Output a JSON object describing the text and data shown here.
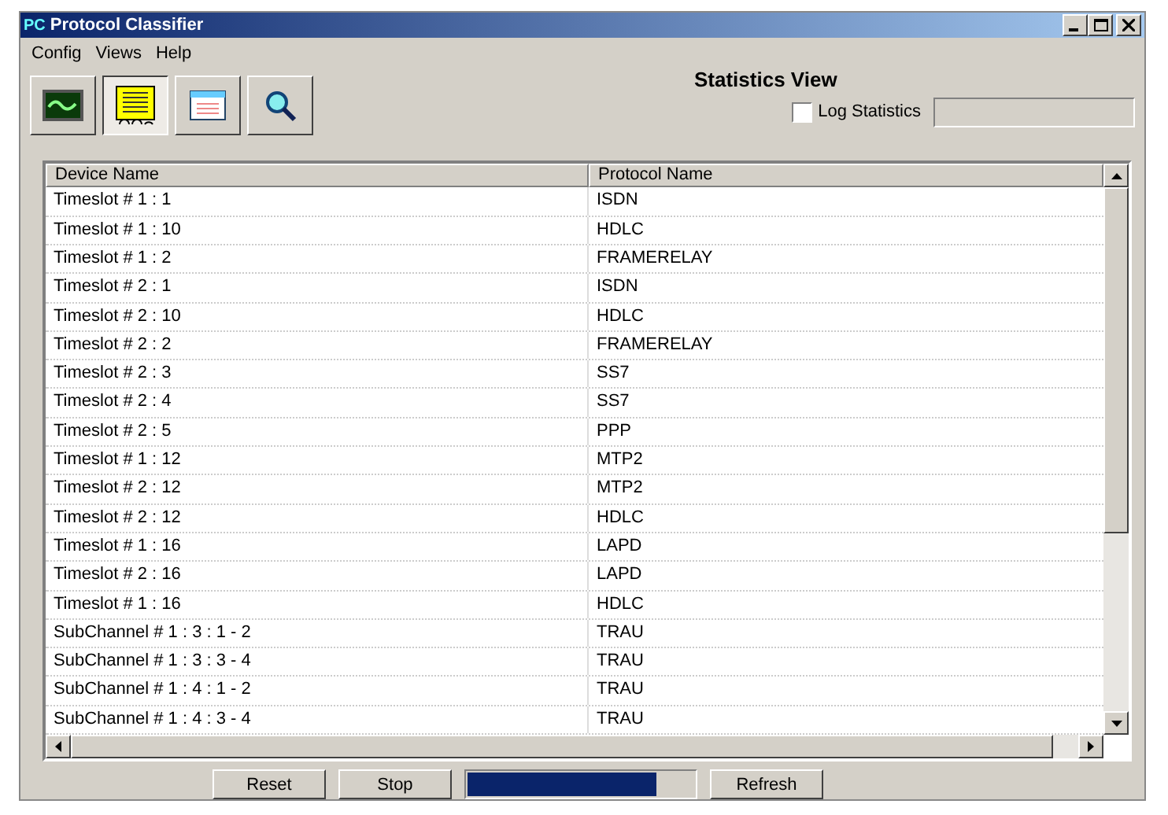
{
  "window": {
    "icon": "PC",
    "title": "Protocol Classifier"
  },
  "menu": [
    "Config",
    "Views",
    "Help"
  ],
  "toolbar": [
    {
      "kind": "scope",
      "selected": false
    },
    {
      "kind": "tape",
      "selected": true
    },
    {
      "kind": "window",
      "selected": false
    },
    {
      "kind": "search",
      "selected": false
    }
  ],
  "statistics": {
    "title": "Statistics View",
    "log_label": "Log Statistics",
    "log_checked": false
  },
  "table": {
    "columns": [
      "Device Name",
      "Protocol Name"
    ],
    "rows": [
      [
        "Timeslot # 1 : 1",
        "ISDN"
      ],
      [
        "Timeslot # 1 : 10",
        "HDLC"
      ],
      [
        "Timeslot # 1 : 2",
        "FRAMERELAY"
      ],
      [
        "Timeslot # 2 : 1",
        "ISDN"
      ],
      [
        "Timeslot # 2 : 10",
        "HDLC"
      ],
      [
        "Timeslot # 2 : 2",
        "FRAMERELAY"
      ],
      [
        "Timeslot # 2 : 3",
        "SS7"
      ],
      [
        "Timeslot # 2 : 4",
        "SS7"
      ],
      [
        "Timeslot # 2 : 5",
        "PPP"
      ],
      [
        "Timeslot # 1 : 12",
        "MTP2"
      ],
      [
        "Timeslot # 2 : 12",
        "MTP2"
      ],
      [
        "Timeslot # 2 : 12",
        "HDLC"
      ],
      [
        "Timeslot # 1 : 16",
        "LAPD"
      ],
      [
        "Timeslot # 2 : 16",
        "LAPD"
      ],
      [
        "Timeslot # 1 : 16",
        "HDLC"
      ],
      [
        "SubChannel # 1 : 3 : 1 - 2",
        "TRAU"
      ],
      [
        "SubChannel # 1 : 3 : 3 - 4",
        "TRAU"
      ],
      [
        "SubChannel # 1 : 4 : 1 - 2",
        "TRAU"
      ],
      [
        "SubChannel # 1 : 4 : 3 - 4",
        "TRAU"
      ]
    ]
  },
  "buttons": {
    "reset": "Reset",
    "stop": "Stop",
    "refresh": "Refresh"
  },
  "progress": {
    "level": 0.83
  }
}
